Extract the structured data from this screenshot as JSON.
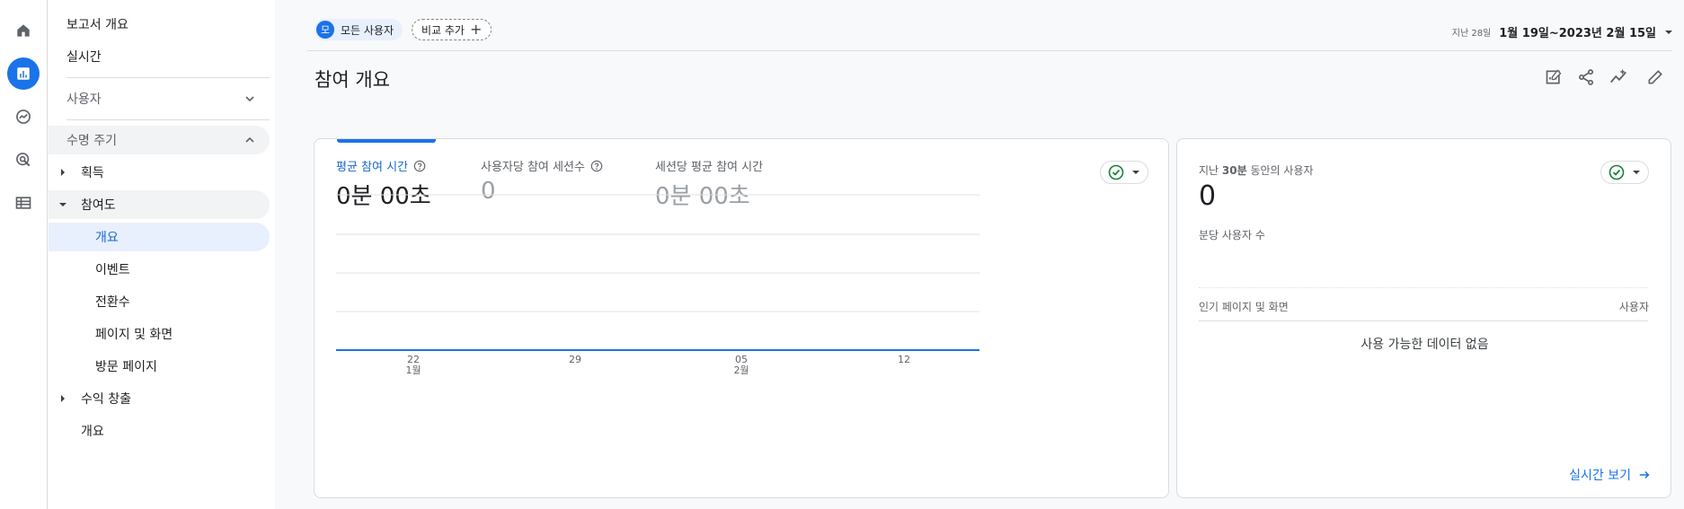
{
  "rail": {
    "icons": [
      "home-icon",
      "reports-icon",
      "explore-icon",
      "advertising-icon",
      "configure-icon"
    ],
    "accent": "#1a73e8"
  },
  "nav": {
    "reports_overview": "보고서 개요",
    "realtime": "실시간",
    "user": "사용자",
    "lifecycle": "수명 주기",
    "acquisition": "획득",
    "engagement": "참여도",
    "engagement_children": [
      "개요",
      "이벤트",
      "전환수",
      "페이지 및 화면",
      "방문 페이지"
    ],
    "monetization": "수익 창출",
    "overview": "개요"
  },
  "filter": {
    "all_users_avatar": "모",
    "all_users": "모든 사용자",
    "add_comparison": "비교 추가"
  },
  "date": {
    "prefix": "지난 28일",
    "range": "1월 19일~2023년 2월 15일"
  },
  "page": {
    "title": "참여 개요"
  },
  "metrics": [
    {
      "label": "평균 참여 시간",
      "value": "0분 00초"
    },
    {
      "label": "사용자당 참여 세션수",
      "value": "0"
    },
    {
      "label": "세션당 평균 참여 시간",
      "value": "0분 00초"
    }
  ],
  "chart_data": {
    "type": "line",
    "x": [
      "22",
      "29",
      "05",
      "12"
    ],
    "x_month_labels": [
      "1월",
      "",
      "2월",
      ""
    ],
    "series": [
      {
        "values": [
          0,
          0,
          0,
          0
        ]
      }
    ],
    "grid": true,
    "color": "#1a73e8"
  },
  "realtime_card": {
    "label_prefix": "지난 ",
    "label_bold": "30분",
    "label_suffix": " 동안의 사용자",
    "value": "0",
    "per_minute": "분당 사용자 수",
    "col_left": "인기 페이지 및 화면",
    "col_right": "사용자",
    "empty": "사용 가능한 데이터 없음",
    "link": "실시간 보기"
  },
  "colors": {
    "accent": "#1a73e8",
    "status_ok": "#188038"
  }
}
